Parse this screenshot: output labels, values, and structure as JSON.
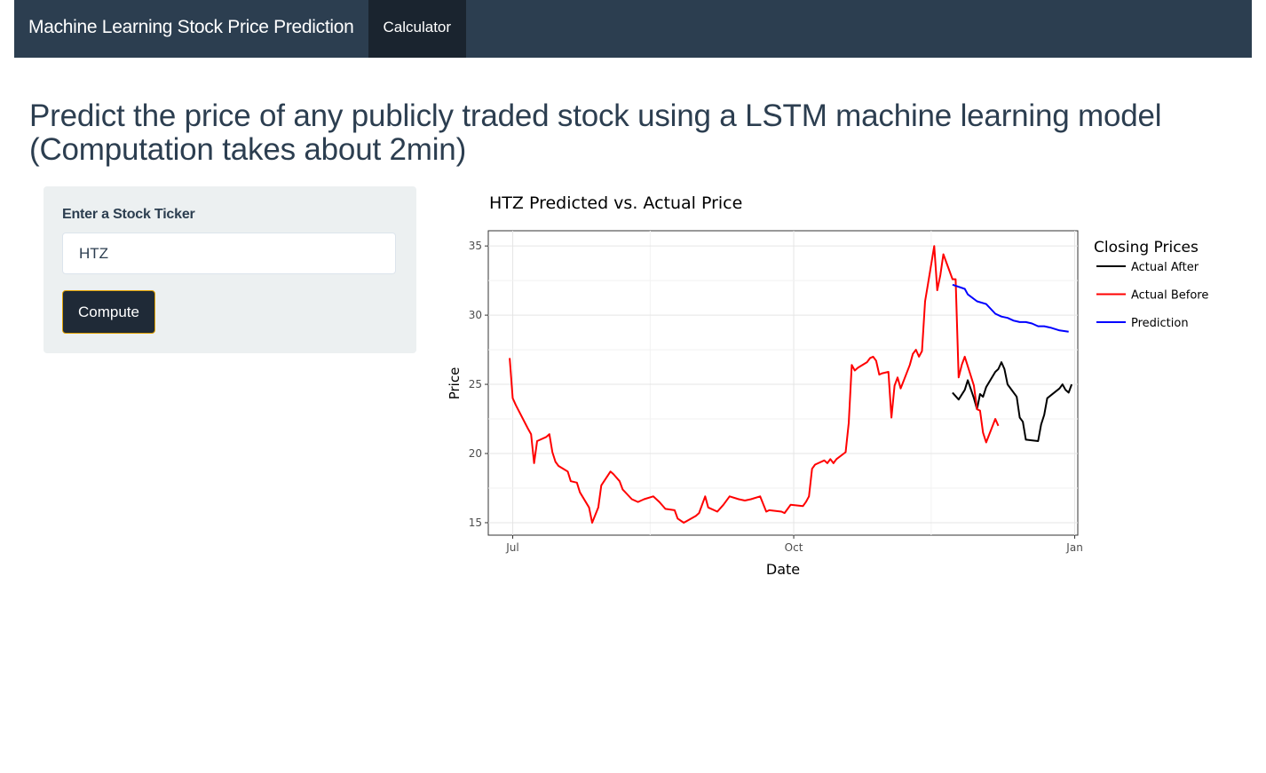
{
  "navbar": {
    "brand": "Machine Learning Stock Price Prediction",
    "tabs": [
      {
        "label": "Calculator",
        "active": true
      }
    ]
  },
  "page": {
    "title": "Predict the price of any publicly traded stock using a LSTM machine learning model (Computation takes about 2min)"
  },
  "form": {
    "ticker_label": "Enter a Stock Ticker",
    "ticker_value": "HTZ",
    "compute_label": "Compute"
  },
  "colors": {
    "navbar": "#2c3e50",
    "nav_active": "#1a242f",
    "well": "#ecf0f1",
    "button": "#1f2a37",
    "button_border": "#e0a100",
    "actual_after": "#000000",
    "actual_before": "#ff0000",
    "prediction": "#0000ff"
  },
  "chart_data": {
    "type": "line",
    "title": "HTZ Predicted vs. Actual Price",
    "xlabel": "Date",
    "ylabel": "Price",
    "x_ticks": [
      "Jul",
      "Oct",
      "Jan"
    ],
    "y_ticks": [
      15,
      20,
      25,
      30,
      35
    ],
    "ylim": [
      14.1,
      36.1
    ],
    "grid": true,
    "legend_title": "Closing Prices",
    "legend_position": "right",
    "series": [
      {
        "name": "Actual After",
        "color": "#000000",
        "points": [
          [
            "2021-11-22",
            24.4
          ],
          [
            "2021-11-24",
            23.9
          ],
          [
            "2021-11-26",
            24.6
          ],
          [
            "2021-11-27",
            25.3
          ],
          [
            "2021-11-29",
            24.0
          ],
          [
            "2021-11-30",
            23.2
          ],
          [
            "2021-12-01",
            24.3
          ],
          [
            "2021-12-02",
            24.1
          ],
          [
            "2021-12-03",
            24.8
          ],
          [
            "2021-12-06",
            25.9
          ],
          [
            "2021-12-07",
            26.1
          ],
          [
            "2021-12-08",
            26.6
          ],
          [
            "2021-12-09",
            26.1
          ],
          [
            "2021-12-10",
            25.0
          ],
          [
            "2021-12-13",
            24.1
          ],
          [
            "2021-12-14",
            22.6
          ],
          [
            "2021-12-15",
            22.3
          ],
          [
            "2021-12-16",
            21.0
          ],
          [
            "2021-12-20",
            20.9
          ],
          [
            "2021-12-21",
            22.1
          ],
          [
            "2021-12-22",
            22.8
          ],
          [
            "2021-12-23",
            24.0
          ],
          [
            "2021-12-27",
            24.7
          ],
          [
            "2021-12-28",
            25.0
          ],
          [
            "2021-12-29",
            24.6
          ],
          [
            "2021-12-30",
            24.4
          ],
          [
            "2021-12-31",
            25.0
          ]
        ]
      },
      {
        "name": "Actual Before",
        "color": "#ff0000",
        "points": [
          [
            "2021-06-30",
            26.9
          ],
          [
            "2021-07-01",
            24.0
          ],
          [
            "2021-07-02",
            23.5
          ],
          [
            "2021-07-06",
            21.8
          ],
          [
            "2021-07-07",
            21.4
          ],
          [
            "2021-07-08",
            19.3
          ],
          [
            "2021-07-09",
            20.9
          ],
          [
            "2021-07-12",
            21.2
          ],
          [
            "2021-07-13",
            21.4
          ],
          [
            "2021-07-14",
            20.1
          ],
          [
            "2021-07-15",
            19.4
          ],
          [
            "2021-07-16",
            19.1
          ],
          [
            "2021-07-19",
            18.7
          ],
          [
            "2021-07-20",
            18.0
          ],
          [
            "2021-07-22",
            17.9
          ],
          [
            "2021-07-23",
            17.2
          ],
          [
            "2021-07-26",
            16.1
          ],
          [
            "2021-07-27",
            15.0
          ],
          [
            "2021-07-29",
            16.1
          ],
          [
            "2021-07-30",
            17.7
          ],
          [
            "2021-08-02",
            18.7
          ],
          [
            "2021-08-03",
            18.5
          ],
          [
            "2021-08-05",
            18.0
          ],
          [
            "2021-08-06",
            17.4
          ],
          [
            "2021-08-09",
            16.7
          ],
          [
            "2021-08-11",
            16.5
          ],
          [
            "2021-08-13",
            16.7
          ],
          [
            "2021-08-16",
            16.9
          ],
          [
            "2021-08-18",
            16.5
          ],
          [
            "2021-08-20",
            16.0
          ],
          [
            "2021-08-23",
            15.9
          ],
          [
            "2021-08-24",
            15.3
          ],
          [
            "2021-08-26",
            15.0
          ],
          [
            "2021-08-30",
            15.5
          ],
          [
            "2021-08-31",
            15.7
          ],
          [
            "2021-09-02",
            16.9
          ],
          [
            "2021-09-03",
            16.1
          ],
          [
            "2021-09-06",
            15.8
          ],
          [
            "2021-09-08",
            16.3
          ],
          [
            "2021-09-10",
            16.9
          ],
          [
            "2021-09-13",
            16.7
          ],
          [
            "2021-09-15",
            16.6
          ],
          [
            "2021-09-17",
            16.7
          ],
          [
            "2021-09-20",
            16.9
          ],
          [
            "2021-09-22",
            15.8
          ],
          [
            "2021-09-23",
            15.9
          ],
          [
            "2021-09-27",
            15.8
          ],
          [
            "2021-09-28",
            15.7
          ],
          [
            "2021-09-29",
            16.0
          ],
          [
            "2021-09-30",
            16.3
          ],
          [
            "2021-10-04",
            16.2
          ],
          [
            "2021-10-05",
            16.5
          ],
          [
            "2021-10-06",
            16.9
          ],
          [
            "2021-10-07",
            18.9
          ],
          [
            "2021-10-08",
            19.2
          ],
          [
            "2021-10-11",
            19.5
          ],
          [
            "2021-10-12",
            19.3
          ],
          [
            "2021-10-13",
            19.6
          ],
          [
            "2021-10-14",
            19.3
          ],
          [
            "2021-10-15",
            19.6
          ],
          [
            "2021-10-18",
            20.1
          ],
          [
            "2021-10-19",
            22.2
          ],
          [
            "2021-10-20",
            26.4
          ],
          [
            "2021-10-21",
            26.0
          ],
          [
            "2021-10-22",
            26.2
          ],
          [
            "2021-10-25",
            26.6
          ],
          [
            "2021-10-26",
            26.9
          ],
          [
            "2021-10-27",
            27.0
          ],
          [
            "2021-10-28",
            26.7
          ],
          [
            "2021-10-29",
            25.7
          ],
          [
            "2021-10-30",
            25.8
          ],
          [
            "2021-11-01",
            25.9
          ],
          [
            "2021-11-02",
            22.6
          ],
          [
            "2021-11-03",
            24.9
          ],
          [
            "2021-11-04",
            25.5
          ],
          [
            "2021-11-05",
            24.7
          ],
          [
            "2021-11-08",
            26.4
          ],
          [
            "2021-11-09",
            27.2
          ],
          [
            "2021-11-10",
            27.5
          ],
          [
            "2021-11-11",
            27.0
          ],
          [
            "2021-11-12",
            27.4
          ],
          [
            "2021-11-13",
            31.0
          ],
          [
            "2021-11-14",
            32.3
          ],
          [
            "2021-11-16",
            35.0
          ],
          [
            "2021-11-17",
            31.8
          ],
          [
            "2021-11-18",
            32.9
          ],
          [
            "2021-11-19",
            34.4
          ],
          [
            "2021-11-22",
            32.6
          ],
          [
            "2021-11-23",
            32.6
          ],
          [
            "2021-11-24",
            25.5
          ],
          [
            "2021-11-25",
            26.4
          ],
          [
            "2021-11-26",
            27.0
          ],
          [
            "2021-11-29",
            24.9
          ],
          [
            "2021-11-30",
            23.2
          ],
          [
            "2021-12-01",
            23.1
          ],
          [
            "2021-12-02",
            21.5
          ],
          [
            "2021-12-03",
            20.8
          ],
          [
            "2021-12-06",
            22.5
          ],
          [
            "2021-12-07",
            22.0
          ]
        ]
      },
      {
        "name": "Prediction",
        "color": "#0000ff",
        "points": [
          [
            "2021-11-22",
            32.2
          ],
          [
            "2021-11-26",
            31.9
          ],
          [
            "2021-11-27",
            31.5
          ],
          [
            "2021-11-30",
            31.0
          ],
          [
            "2021-12-03",
            30.8
          ],
          [
            "2021-12-06",
            30.1
          ],
          [
            "2021-12-08",
            29.9
          ],
          [
            "2021-12-10",
            29.8
          ],
          [
            "2021-12-12",
            29.6
          ],
          [
            "2021-12-14",
            29.5
          ],
          [
            "2021-12-16",
            29.5
          ],
          [
            "2021-12-18",
            29.4
          ],
          [
            "2021-12-20",
            29.2
          ],
          [
            "2021-12-22",
            29.2
          ],
          [
            "2021-12-24",
            29.1
          ],
          [
            "2021-12-27",
            28.9
          ],
          [
            "2021-12-30",
            28.8
          ]
        ]
      }
    ]
  }
}
